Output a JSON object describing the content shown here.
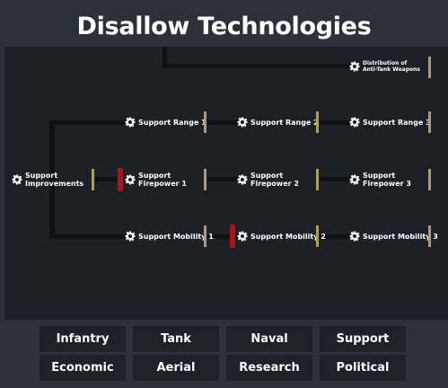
{
  "title": "Disallow Technologies",
  "tree": {
    "nodes": {
      "distribution": "Distribution of\nAnti-Tank Weapons",
      "improvements": "Support\nImprovements",
      "range1": "Support Range 1",
      "range2": "Support Range 2",
      "range3": "Support Range 3",
      "firepower1": "Support\nFirepower 1",
      "firepower2": "Support\nFirepower 2",
      "firepower3": "Support\nFirepower 3",
      "mobility1": "Support Mobility 1",
      "mobility2": "Support Mobility 2",
      "mobility3": "Support Mobility 3"
    },
    "disallowed": [
      "firepower1",
      "mobility2"
    ],
    "icon": "gear-icon"
  },
  "categories": [
    "Infantry",
    "Tank",
    "Naval",
    "Support",
    "Economic",
    "Aerial",
    "Research",
    "Political"
  ],
  "colors": {
    "background": "#2b3139",
    "panel": "#1d2026",
    "button": "#1e2228",
    "allowed_bar": "#b19b61",
    "disallowed_bar": "#a3161b"
  }
}
